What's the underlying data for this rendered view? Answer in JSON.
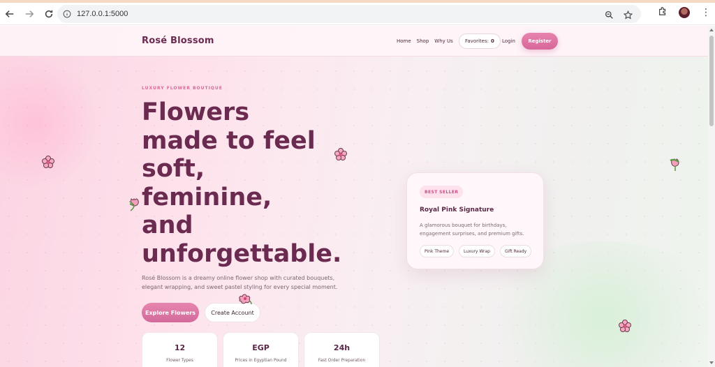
{
  "browser": {
    "url": "127.0.0.1:5000",
    "icons": [
      "back-arrow-icon",
      "forward-arrow-icon",
      "reload-icon",
      "info-icon",
      "zoom-icon",
      "star-icon",
      "extensions-icon",
      "profile-avatar",
      "menu-kebab-icon"
    ]
  },
  "header": {
    "brand": "Rosé Blossom",
    "nav": [
      "Home",
      "Shop",
      "Why Us"
    ],
    "favorites_label": "Favorites:",
    "favorites_count": "0",
    "login": "Login",
    "register": "Register"
  },
  "hero": {
    "eyebrow": "LUXURY FLOWER BOUTIQUE",
    "headline_lines": [
      "Flowers",
      "made to feel",
      "soft,",
      "feminine,",
      "and",
      "unforgettable."
    ],
    "description": "Rosé Blossom is a dreamy online flower shop with curated bouquets, elegant wrapping, and sweet pastel styling for every special moment.",
    "primary_button": "Explore Flowers",
    "secondary_button": "Create Account"
  },
  "stats": [
    {
      "value": "12",
      "label": "Flower Types"
    },
    {
      "value": "EGP",
      "label": "Prices in Egyptian Pound"
    },
    {
      "value": "24h",
      "label": "Fast Order Preparation"
    }
  ],
  "featured": {
    "badge": "BEST SELLER",
    "title": "Royal Pink Signature",
    "description": "A glamorous bouquet for birthdays, engagement surprises, and premium gifts.",
    "tags": [
      "Pink Theme",
      "Luxury Wrap",
      "Gift Ready"
    ]
  },
  "colors": {
    "brand": "#6b2a4f",
    "accent": "#d7669a",
    "eyebrow": "#d66a97"
  }
}
